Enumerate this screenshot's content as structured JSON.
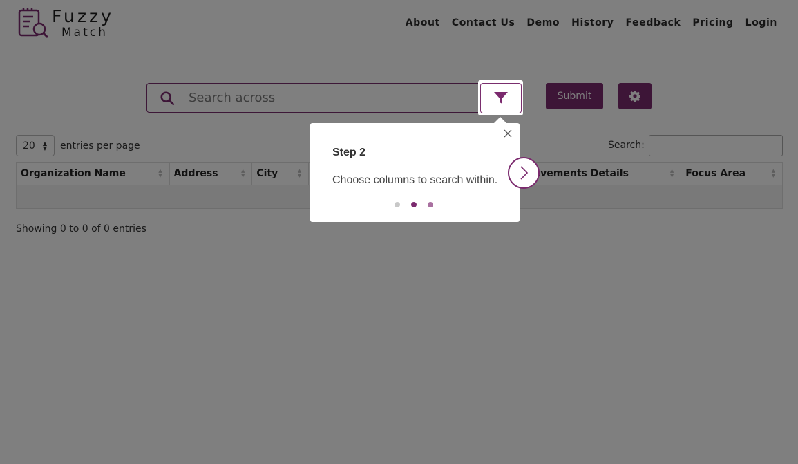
{
  "logo": {
    "line1": "Fuzzy",
    "line2": "Match"
  },
  "nav": {
    "items": [
      "About",
      "Contact Us",
      "Demo",
      "History",
      "Feedback",
      "Pricing",
      "Login"
    ]
  },
  "search": {
    "placeholder": "Search across",
    "value": ""
  },
  "buttons": {
    "submit_label": "Submit"
  },
  "table": {
    "entries_value": "20",
    "entries_label": "entries per page",
    "search_label": "Search:",
    "columns": [
      "Organization Name",
      "Address",
      "City",
      "",
      "",
      "evements Details",
      "Focus Area"
    ],
    "info": "Showing 0 to 0 of 0 entries"
  },
  "tour": {
    "title": "Step 2",
    "text": "Choose columns to search within.",
    "steps_total": 3,
    "current_step": 2
  },
  "colors": {
    "accent": "#7b2a6e",
    "dot_inactive": "#c8c8c8",
    "dot_active": "#7b2a6e",
    "dot_upcoming": "#a970a0"
  }
}
